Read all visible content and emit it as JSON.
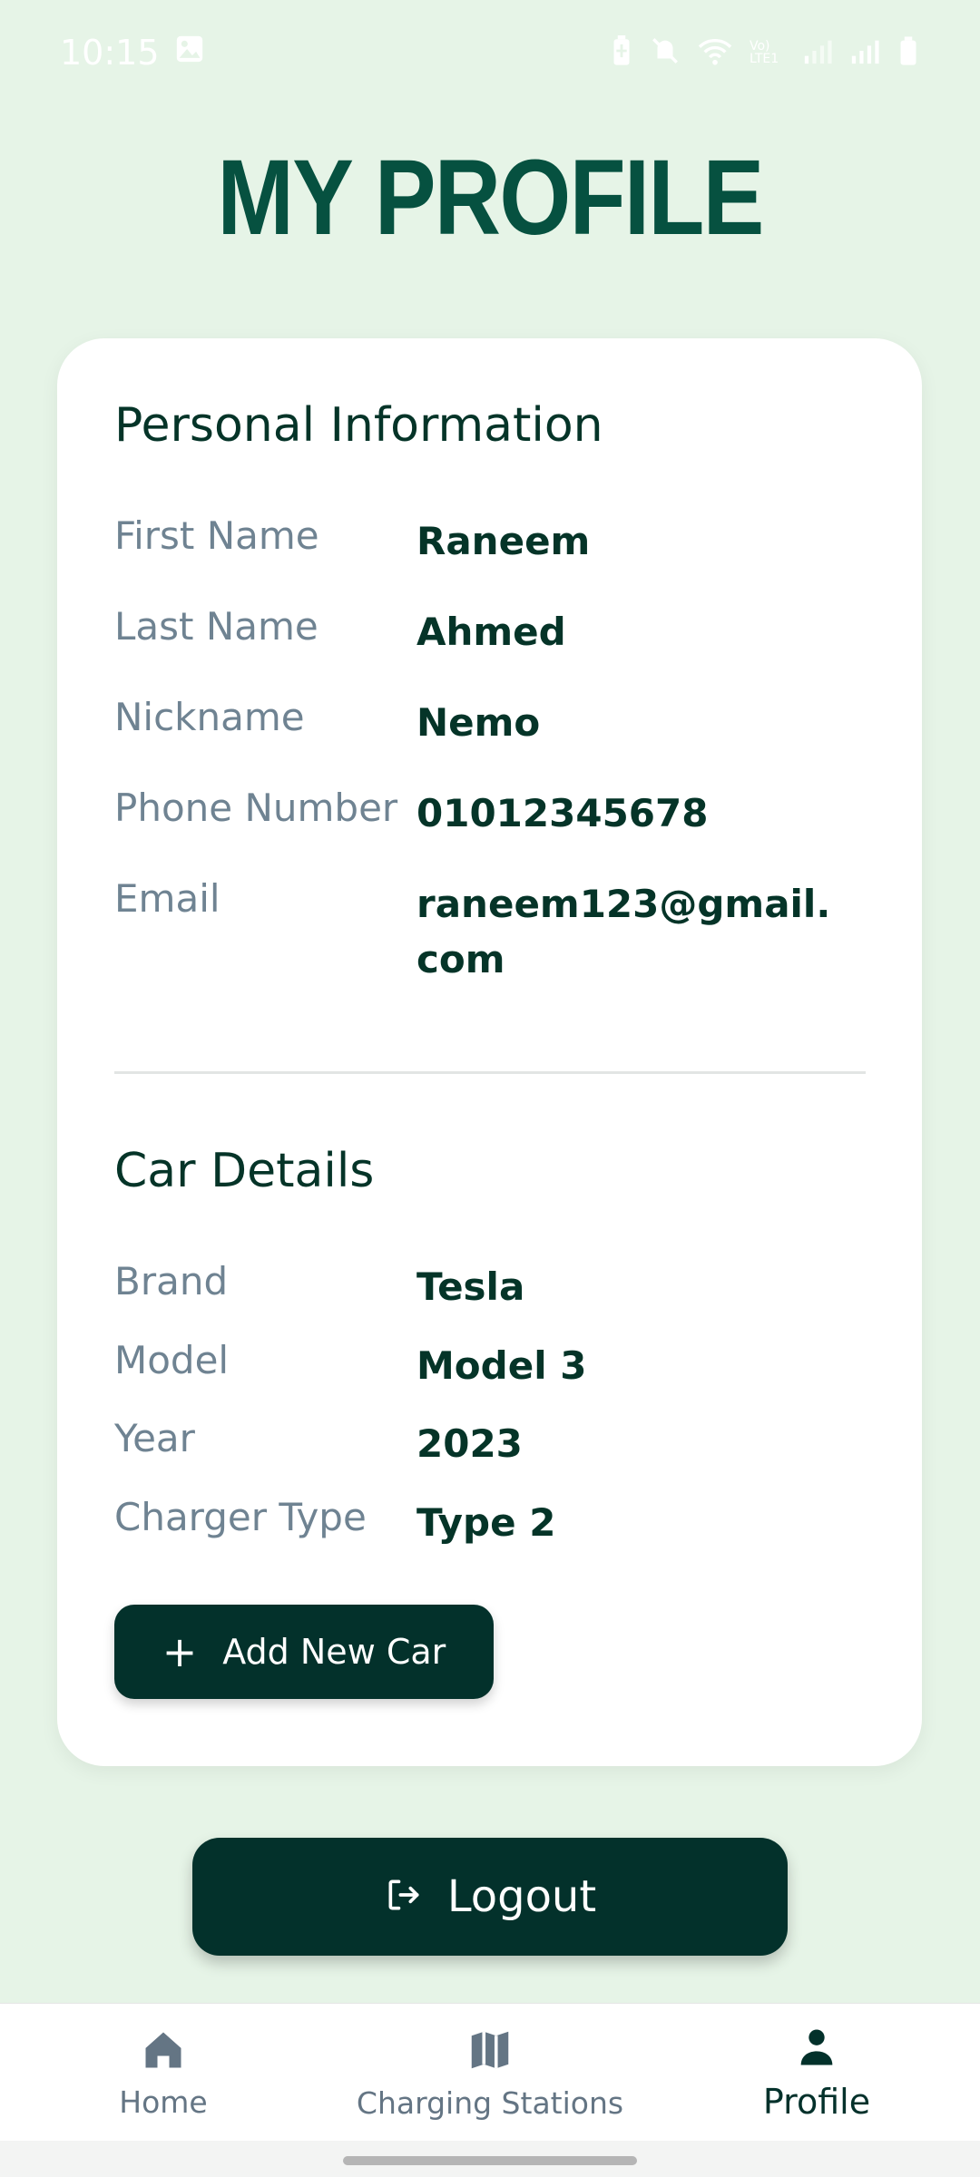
{
  "status_bar": {
    "time": "10:15",
    "network_label": "Vo) LTE1"
  },
  "page": {
    "title": "MY PROFILE"
  },
  "personal": {
    "title": "Personal Information",
    "fields": [
      {
        "label": "First Name",
        "value": "Raneem"
      },
      {
        "label": "Last Name",
        "value": "Ahmed"
      },
      {
        "label": "Nickname",
        "value": "Nemo"
      },
      {
        "label": "Phone Number",
        "value": "01012345678"
      },
      {
        "label": "Email",
        "value": "raneem123@gmail.com"
      }
    ]
  },
  "car": {
    "title": "Car Details",
    "fields": [
      {
        "label": "Brand",
        "value": "Tesla"
      },
      {
        "label": "Model",
        "value": "Model 3"
      },
      {
        "label": "Year",
        "value": "2023"
      },
      {
        "label": "Charger Type",
        "value": "Type 2"
      }
    ],
    "add_button": {
      "icon": "plus-icon",
      "label": "Add New Car"
    }
  },
  "logout": {
    "icon": "logout-icon",
    "label": "Logout"
  },
  "nav": {
    "items": [
      {
        "label": "Home",
        "icon": "home-icon"
      },
      {
        "label": "Charging Stations",
        "icon": "map-icon"
      },
      {
        "label": "Profile",
        "icon": "person-icon",
        "active": true
      }
    ]
  },
  "colors": {
    "background": "#e6f4e7",
    "title": "#065140",
    "primary_dark": "#03312b",
    "label_gray": "#6f8392",
    "card": "#ffffff"
  }
}
